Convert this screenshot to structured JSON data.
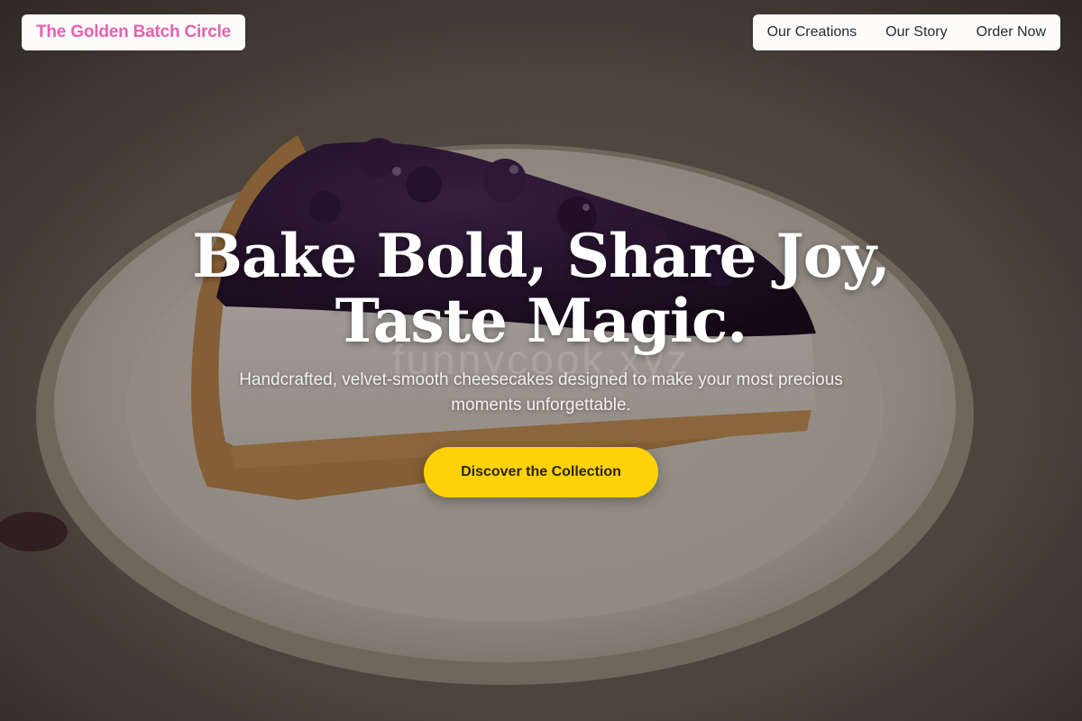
{
  "brand": {
    "name": "The Golden Batch Circle",
    "color": "#e860b0"
  },
  "nav": {
    "items": [
      {
        "label": "Our Creations"
      },
      {
        "label": "Our Story"
      },
      {
        "label": "Order Now"
      }
    ]
  },
  "hero": {
    "headline_line1": "Bake Bold, Share Joy,",
    "headline_line2": "Taste Magic.",
    "watermark": "funnycook.xyz",
    "subtitle": "Handcrafted, velvet-smooth cheesecakes designed to make your most precious moments unforgettable.",
    "cta_label": "Discover the Collection",
    "cta_color": "#fdd207",
    "image_description": "blueberry-cheesecake-slice-photo"
  }
}
